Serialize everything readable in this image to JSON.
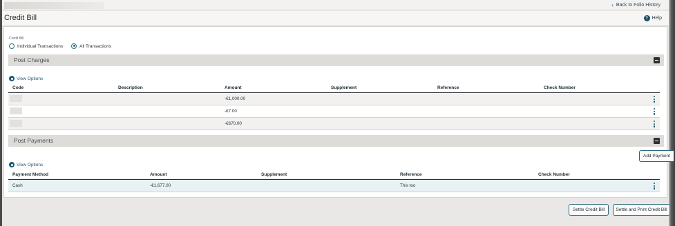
{
  "header": {
    "back_link": "Back to Folio History",
    "title": "Credit Bill",
    "help": "Help"
  },
  "credit_bill_filter": {
    "label": "Credit Bill",
    "options": [
      "Individual Transactions",
      "All Transactions"
    ],
    "selected": "All Transactions"
  },
  "post_charges": {
    "title": "Post Charges",
    "view_options": "View Options",
    "columns": [
      "Code",
      "Description",
      "Amount",
      "Supplement",
      "Reference",
      "Check Number"
    ],
    "rows": [
      {
        "code": "",
        "description": "",
        "amount": "-€1,000.00",
        "supplement": "",
        "reference": "",
        "check_number": ""
      },
      {
        "code": "",
        "description": "",
        "amount": "-€7.00",
        "supplement": "",
        "reference": "",
        "check_number": ""
      },
      {
        "code": "",
        "description": "",
        "amount": "-€670.00",
        "supplement": "",
        "reference": "",
        "check_number": ""
      }
    ]
  },
  "post_payments": {
    "title": "Post Payments",
    "add_payment": "Add Payment",
    "view_options": "View Options",
    "columns": [
      "Payment Method",
      "Amount",
      "Supplement",
      "Reference",
      "Check Number"
    ],
    "rows": [
      {
        "payment_method": "Cash",
        "amount": "-€1,677.00",
        "supplement": "",
        "reference": "This too",
        "check_number": ""
      }
    ]
  },
  "footer": {
    "settle": "Settle Credit Bill",
    "settle_print": "Settle and Print Credit Bill"
  },
  "colors": {
    "accent": "#27687a",
    "section_bar": "#dedcd9",
    "selected_row": "#e8f1f4"
  }
}
